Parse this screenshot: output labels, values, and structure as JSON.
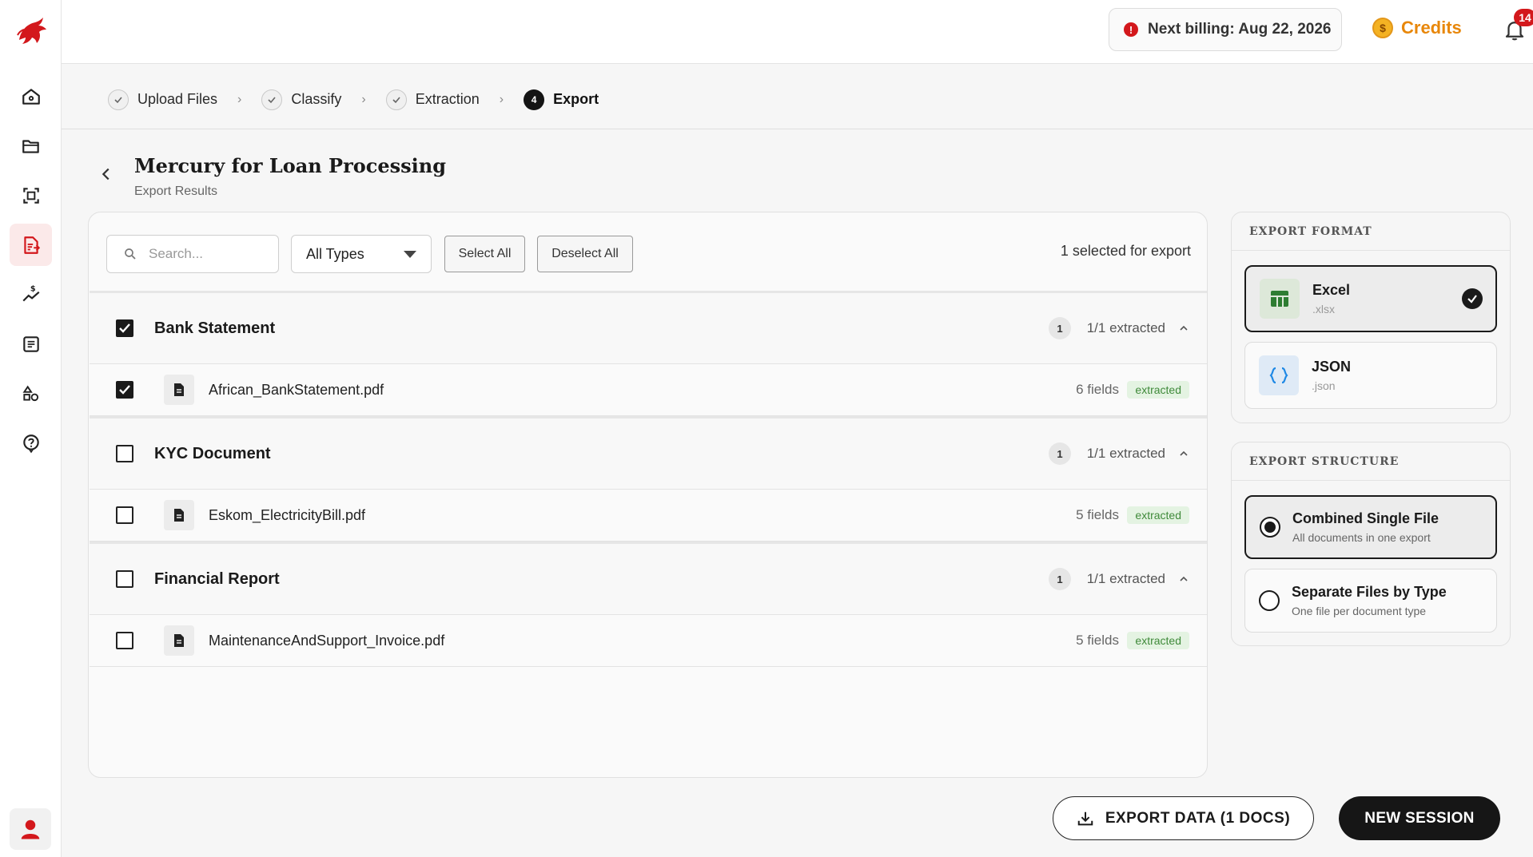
{
  "header": {
    "billing_text": "Next billing: Aug 22, 2026",
    "billing_icon": "!",
    "credits_label": "Credits",
    "coin_symbol": "$",
    "notifications_count": "14"
  },
  "stepper": {
    "steps": [
      {
        "label": "Upload Files",
        "state": "done"
      },
      {
        "label": "Classify",
        "state": "done"
      },
      {
        "label": "Extraction",
        "state": "done"
      },
      {
        "label": "Export",
        "state": "current",
        "number": "4"
      }
    ]
  },
  "page": {
    "title": "Mercury for Loan Processing",
    "subtitle": "Export Results"
  },
  "toolbar": {
    "search_placeholder": "Search...",
    "type_filter": "All Types",
    "select_all": "Select All",
    "deselect_all": "Deselect All",
    "selected_text": "1 selected for export"
  },
  "groups": [
    {
      "title": "Bank Statement",
      "count": "1",
      "extracted": "1/1 extracted",
      "checked": true,
      "files": [
        {
          "name": "African_BankStatement.pdf",
          "fields": "6 fields",
          "status": "extracted",
          "checked": true
        }
      ]
    },
    {
      "title": "KYC Document",
      "count": "1",
      "extracted": "1/1 extracted",
      "checked": false,
      "files": [
        {
          "name": "Eskom_ElectricityBill.pdf",
          "fields": "5 fields",
          "status": "extracted",
          "checked": false
        }
      ]
    },
    {
      "title": "Financial Report",
      "count": "1",
      "extracted": "1/1 extracted",
      "checked": false,
      "files": [
        {
          "name": "MaintenanceAndSupport_Invoice.pdf",
          "fields": "5 fields",
          "status": "extracted",
          "checked": false
        }
      ]
    }
  ],
  "export_format": {
    "heading": "EXPORT FORMAT",
    "options": [
      {
        "title": "Excel",
        "ext": ".xlsx",
        "selected": true
      },
      {
        "title": "JSON",
        "ext": ".json",
        "selected": false
      }
    ]
  },
  "export_structure": {
    "heading": "EXPORT STRUCTURE",
    "options": [
      {
        "title": "Combined Single File",
        "sub": "All documents in one export",
        "selected": true
      },
      {
        "title": "Separate Files by Type",
        "sub": "One file per document type",
        "selected": false
      }
    ]
  },
  "actions": {
    "export_label": "EXPORT DATA (1 DOCS)",
    "new_session_label": "NEW SESSION"
  },
  "colors": {
    "brand_red": "#d3181c",
    "credits_orange": "#e8870a",
    "extracted_green": "#3f8a3a"
  }
}
